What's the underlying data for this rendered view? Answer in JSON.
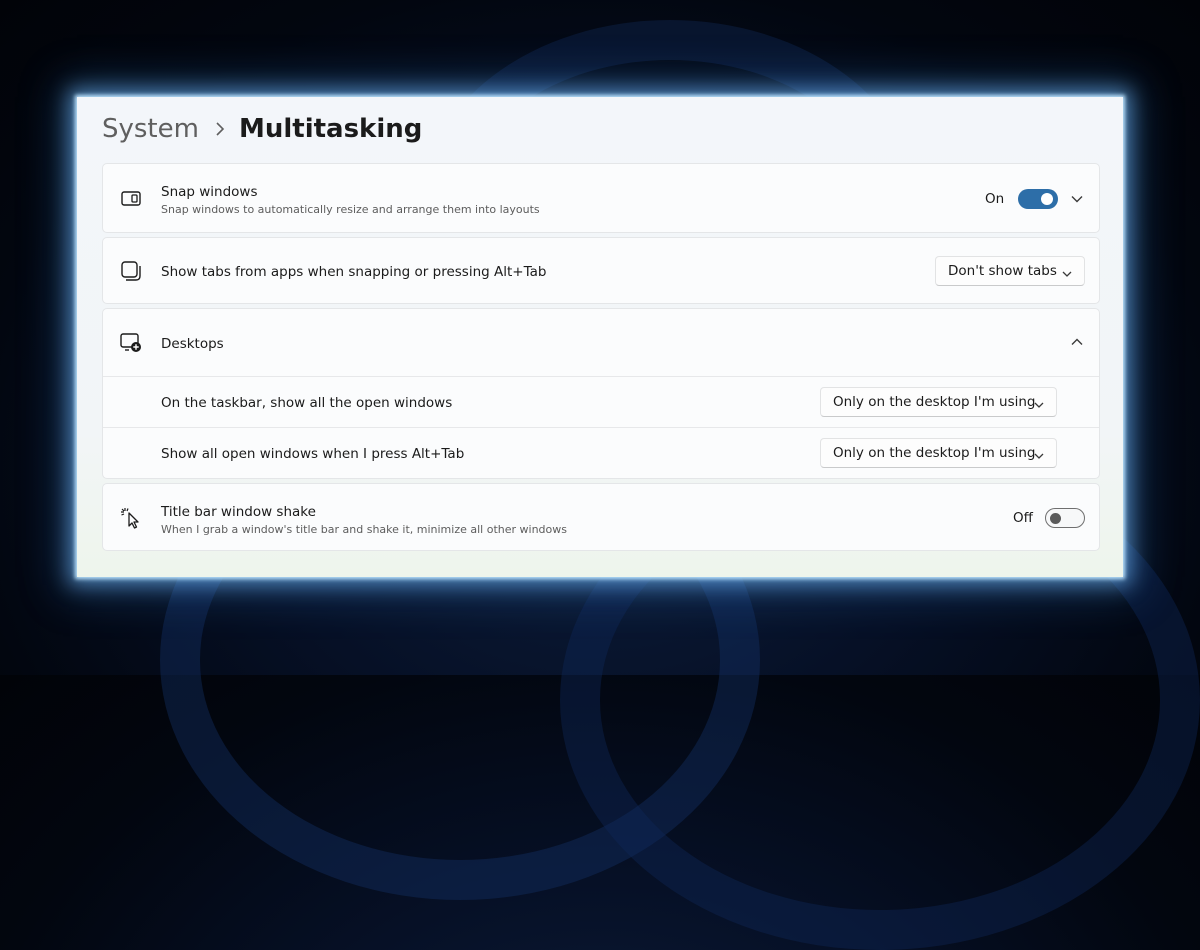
{
  "breadcrumb": {
    "parent": "System",
    "current": "Multitasking"
  },
  "snap_windows": {
    "title": "Snap windows",
    "description": "Snap windows to automatically resize and arrange them into layouts",
    "state_label": "On",
    "toggle_on": true,
    "icon": "snap-layout-icon"
  },
  "show_tabs": {
    "title": "Show tabs from apps when snapping or pressing Alt+Tab",
    "selected": "Don't show tabs",
    "icon": "window-tabs-icon"
  },
  "desktops": {
    "title": "Desktops",
    "icon": "add-desktop-icon",
    "expanded": true,
    "items": [
      {
        "label": "On the taskbar, show all the open windows",
        "selected": "Only on the desktop I'm using"
      },
      {
        "label": "Show all open windows when I press Alt+Tab",
        "selected": "Only on the desktop I'm using"
      }
    ]
  },
  "title_bar_shake": {
    "title": "Title bar window shake",
    "description": "When I grab a window's title bar and shake it, minimize all other windows",
    "state_label": "Off",
    "toggle_on": false,
    "icon": "cursor-shake-icon"
  },
  "colors": {
    "accent": "#2d6ea8",
    "panel_glow": "#9fd4ff"
  }
}
